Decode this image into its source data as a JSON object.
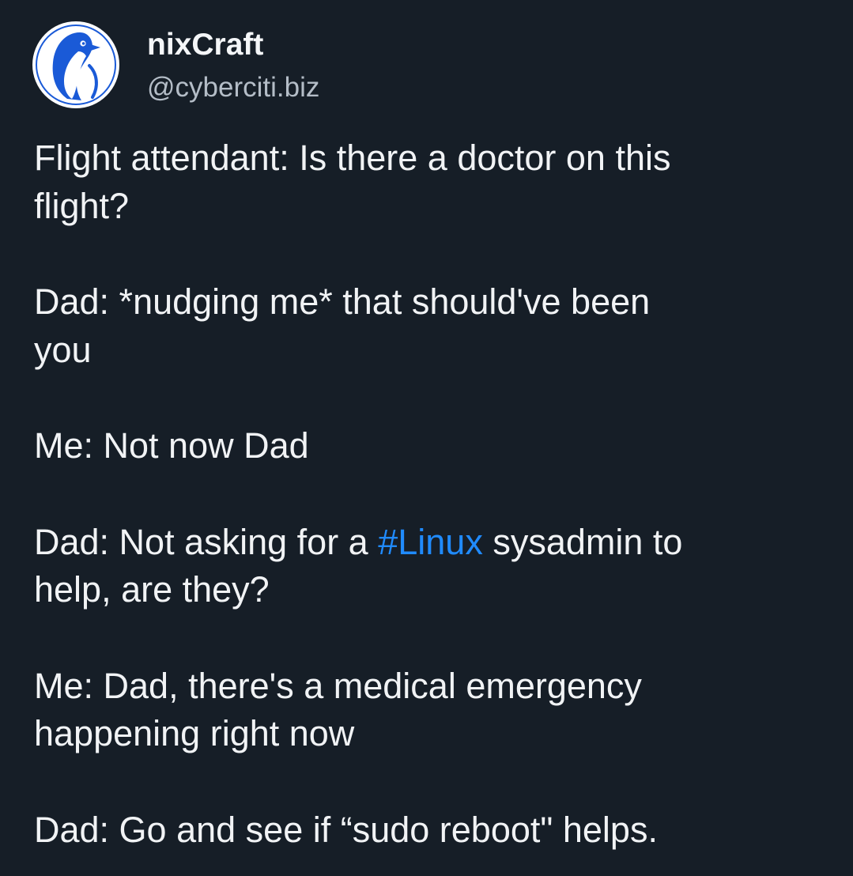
{
  "post": {
    "author": {
      "display_name": "nixCraft",
      "handle": "@cyberciti.biz",
      "avatar_icon": "penguin-avatar-icon"
    },
    "paragraphs": [
      {
        "lines": [
          "Flight attendant: Is there a doctor on this",
          "flight?"
        ]
      },
      {
        "lines": [
          "Dad: *nudging me* that should've been",
          "you"
        ]
      },
      {
        "lines": [
          "Me: Not now Dad"
        ]
      },
      {
        "lines_special": true,
        "before": "Dad: Not asking for a ",
        "hashtag": "#Linux",
        "after": " sysadmin to",
        "line2": "help, are they?"
      },
      {
        "lines": [
          "Me: Dad, there's a medical emergency",
          "happening right now"
        ]
      },
      {
        "lines": [
          "Dad: Go and see if “sudo reboot\" helps."
        ]
      }
    ]
  },
  "colors": {
    "background": "#161e27",
    "text": "#f1f3f5",
    "handle": "#b4bdc7",
    "hashtag": "#208bfe",
    "avatar_blue": "#1a5ad7"
  }
}
